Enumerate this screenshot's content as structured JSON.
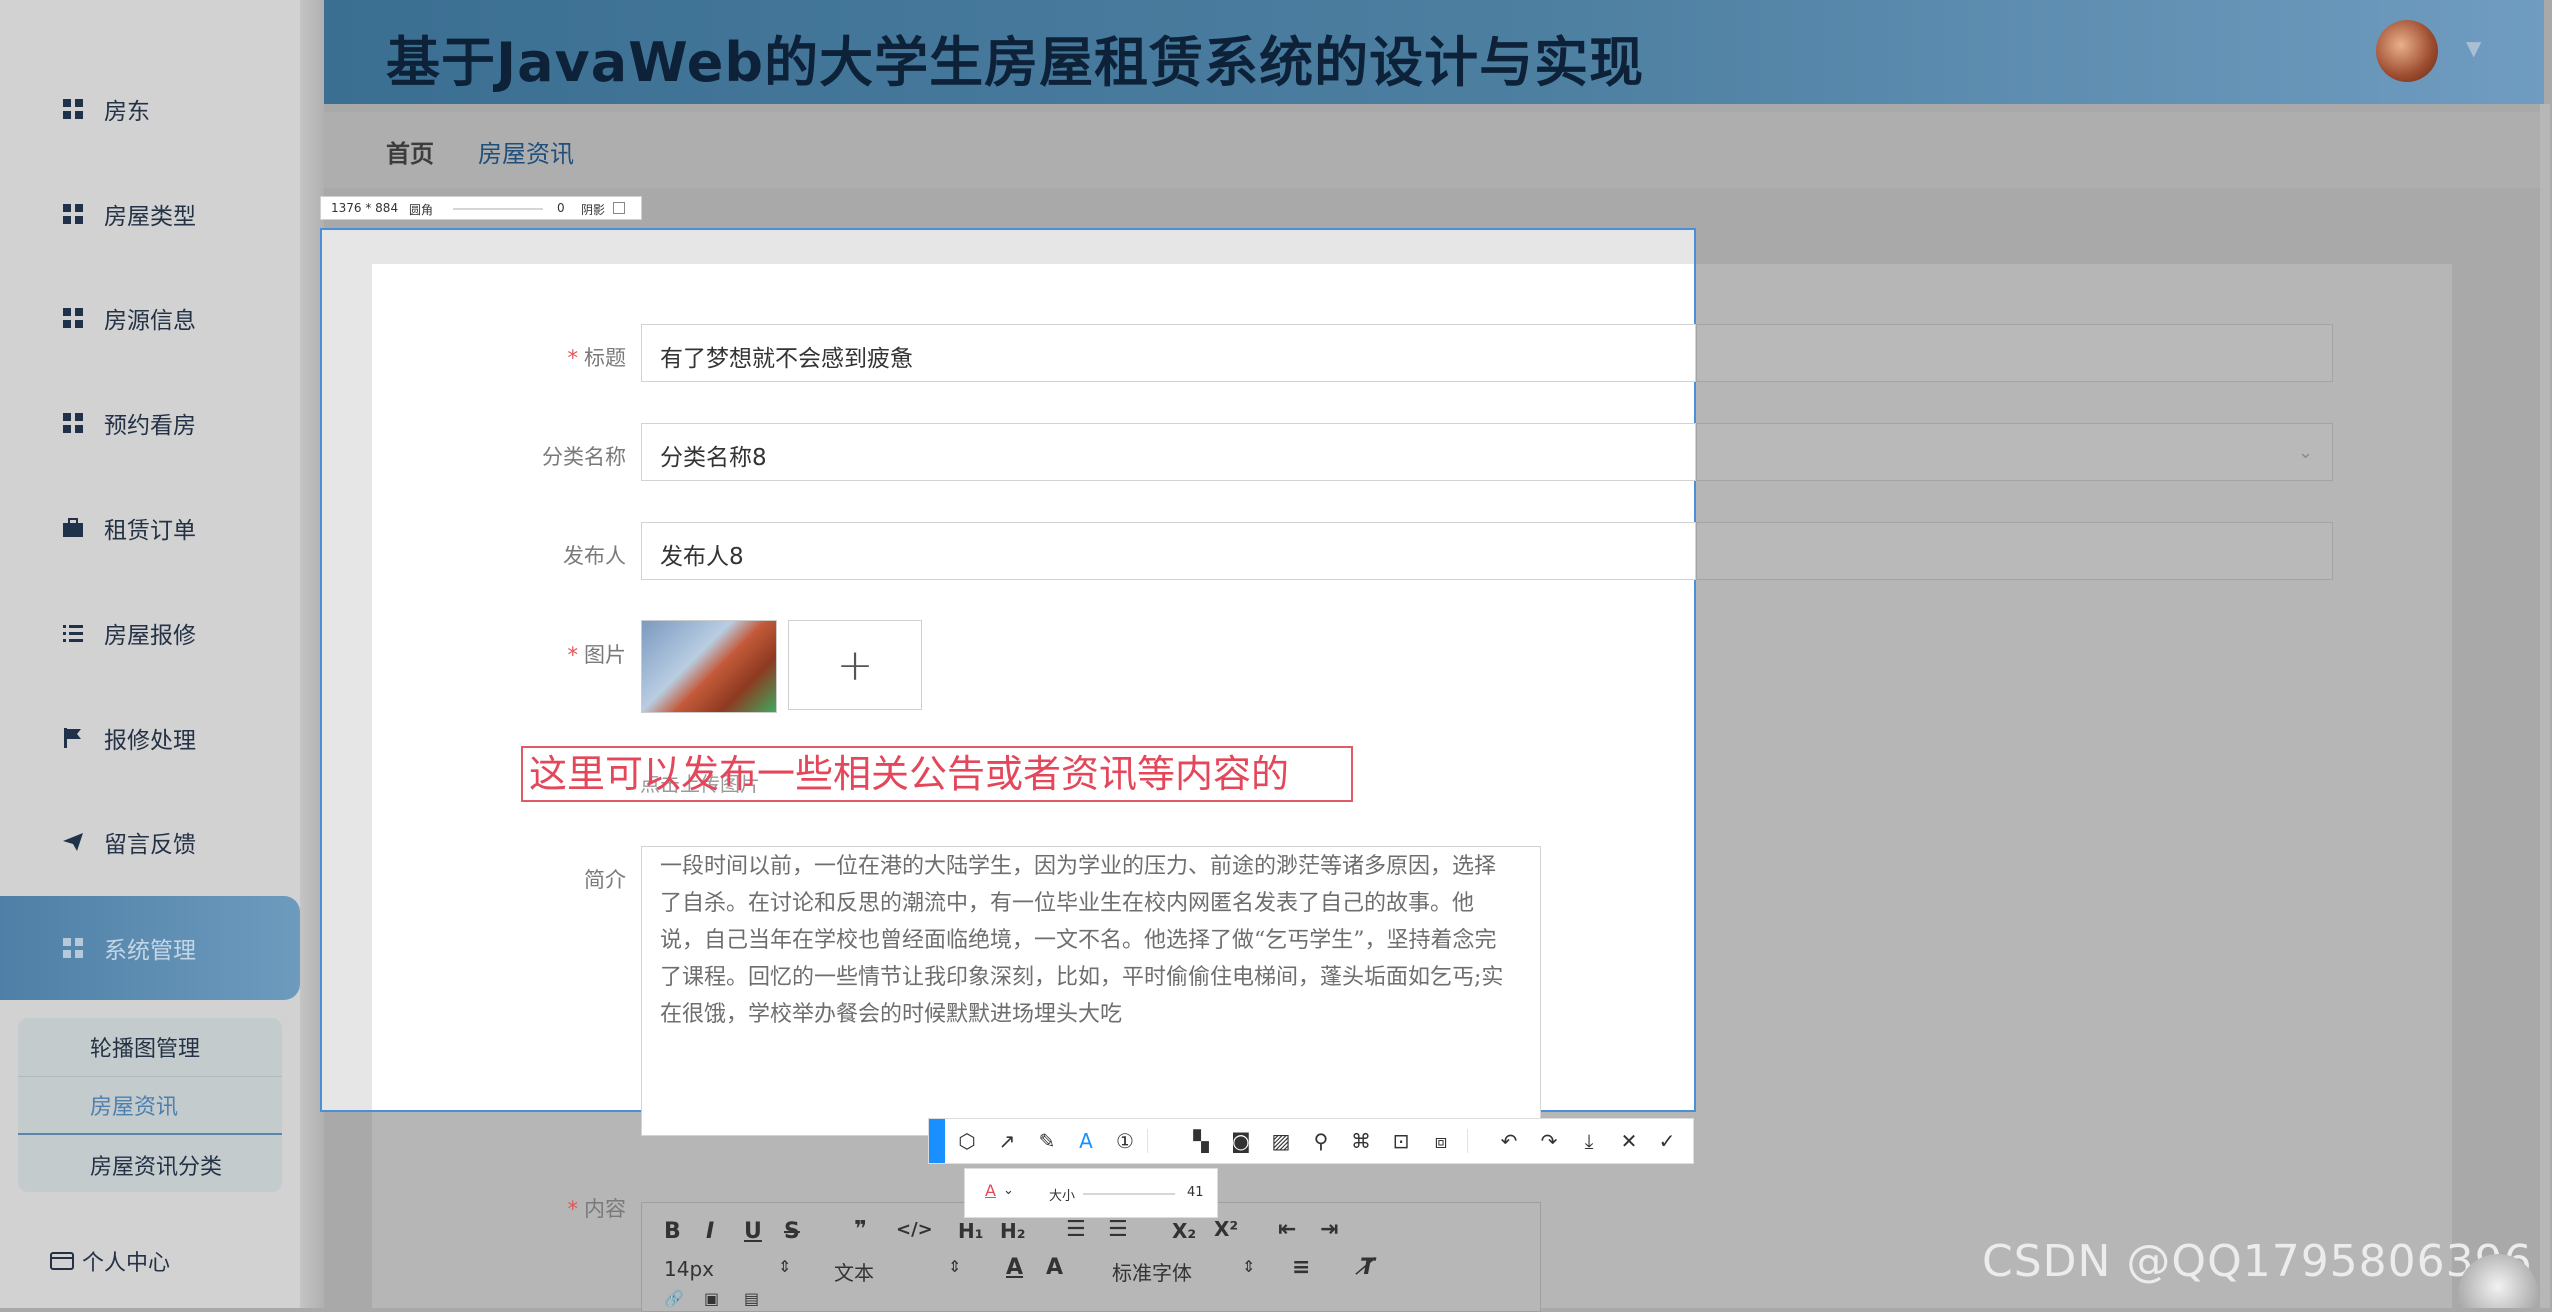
{
  "app": {
    "title": "基于JavaWeb的大学生房屋租赁系统的设计与实现"
  },
  "sidebar": {
    "items": [
      {
        "label": "房东",
        "icon": "grid-icon"
      },
      {
        "label": "房屋类型",
        "icon": "grid-icon"
      },
      {
        "label": "房源信息",
        "icon": "grid-icon"
      },
      {
        "label": "预约看房",
        "icon": "grid-icon"
      },
      {
        "label": "租赁订单",
        "icon": "briefcase-icon"
      },
      {
        "label": "房屋报修",
        "icon": "list-icon"
      },
      {
        "label": "报修处理",
        "icon": "flag-icon"
      },
      {
        "label": "留言反馈",
        "icon": "send-icon"
      },
      {
        "label": "系统管理",
        "icon": "grid-icon"
      }
    ],
    "submenu": [
      "轮播图管理",
      "房屋资讯",
      "房屋资讯分类"
    ],
    "personal": "个人中心"
  },
  "breadcrumb": {
    "home": "首页",
    "current": "房屋资讯"
  },
  "form": {
    "title_label": "标题",
    "title_value": "有了梦想就不会感到疲惫",
    "category_label": "分类名称",
    "category_value": "分类名称8",
    "publisher_label": "发布人",
    "publisher_value": "发布人8",
    "image_label": "图片",
    "upload_plus": "+",
    "upload_hint": "点击上传图片",
    "intro_label": "简介",
    "intro_text": "一段时间以前，一位在港的大陆学生，因为学业的压力、前途的渺茫等诸多原因，选择了自杀。在讨论和反思的潮流中，有一位毕业生在校内网匿名发表了自己的故事。他说，自己当年在学校也曾经面临绝境，一文不名。他选择了做“乞丐学生”，坚持着念完了课程。回忆的一些情节让我印象深刻，比如，平时偷偷住电梯间，蓬头垢面如乞丐;实在很饿，学校举办餐会的时候默默进场埋头大吃",
    "content_label": "内容"
  },
  "annotation": {
    "text": "这里可以发布一些相关公告或者资讯等内容的",
    "color": "#e4475a"
  },
  "capture_bar": {
    "size": "1376 * 884",
    "radius_label": "圆角",
    "radius_value": "0",
    "shadow_label": "阴影"
  },
  "capture_subbar": {
    "size_label": "大小",
    "size_value": "41"
  },
  "editor": {
    "font_size": "14px",
    "block_type": "文本",
    "font_family": "标准字体"
  },
  "watermark": "CSDN @QQ1795806396",
  "colors": {
    "accent": "#1890ff",
    "header": "#4d7fa1",
    "required": "#e15656"
  }
}
